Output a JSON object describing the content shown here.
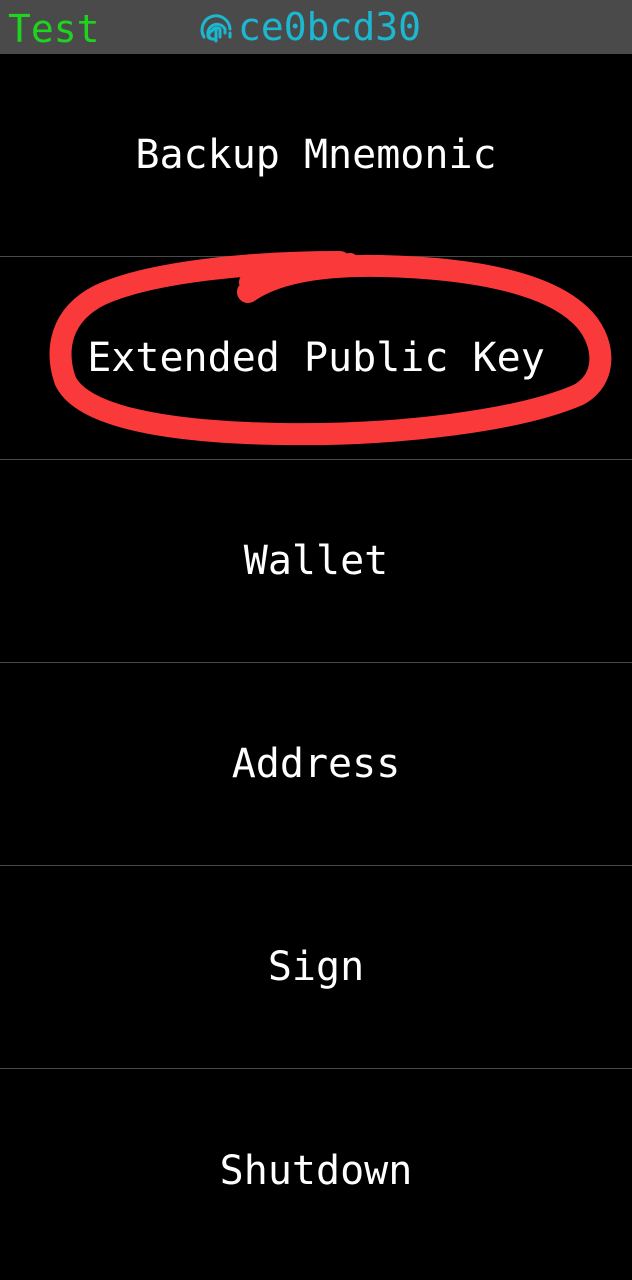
{
  "status_bar": {
    "network_label": "Test",
    "fingerprint": "ce0bcd30",
    "fingerprint_icon": "fingerprint-icon",
    "colors": {
      "background": "#4a4a4a",
      "network": "#1ed41e",
      "fingerprint": "#1cb8d2"
    }
  },
  "menu": {
    "items": [
      {
        "label": "Backup Mnemonic"
      },
      {
        "label": "Extended Public Key"
      },
      {
        "label": "Wallet"
      },
      {
        "label": "Address"
      },
      {
        "label": "Sign"
      },
      {
        "label": "Shutdown"
      }
    ],
    "colors": {
      "background": "#000000",
      "text": "#ffffff",
      "divider": "#4a4a4a"
    }
  },
  "annotation": {
    "shape": "hand-drawn circle",
    "target": "Extended Public Key",
    "color": "#fa3a3a"
  }
}
